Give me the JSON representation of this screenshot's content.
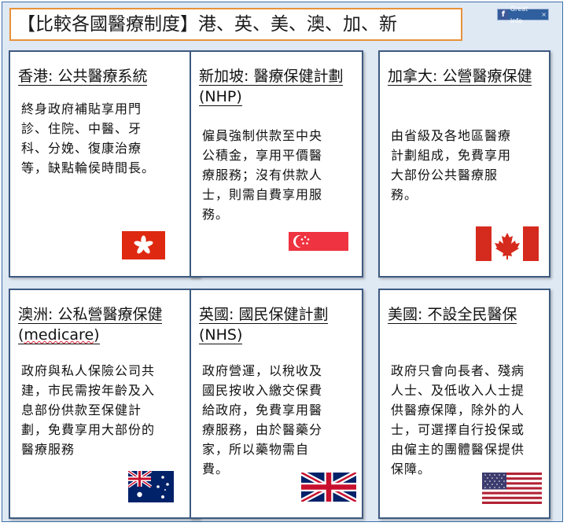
{
  "title": "【比較各國醫療制度】港、英、美、澳、加、新",
  "badge": {
    "fb": "f",
    "label": "Great Info",
    "close": "×"
  },
  "cards": [
    {
      "heading": "香港: 公共醫療系統",
      "body": "終身政府補貼享用門診、住院、中醫、牙科、分娩、復康治療等，缺點輪侯時間長。",
      "flag": "hong-kong-flag"
    },
    {
      "heading": "新加坡: 醫療保健計劃(NHP)",
      "body": "僱員強制供款至中央公積金，享用平價醫療服務；沒有供款人士，則需自費享用服務。",
      "flag": "singapore-flag"
    },
    {
      "heading": "加拿大: 公營醫療保健",
      "body": "由省級及各地區醫療計劃組成，免費享用大部份公共醫療服務。",
      "flag": "canada-flag"
    },
    {
      "heading_a": "澳洲: 公私營醫療保健(",
      "heading_b": "medicare",
      "heading_c": ")",
      "body": "政府與私人保險公司共建，市民需按年齡及入息部份供款至保健計劃，免費享用大部份的醫療服務",
      "flag": "australia-flag"
    },
    {
      "heading": "英國: 國民保健計劃(NHS)",
      "body": "政府營運，以稅收及國民按收入繳交保費給政府，免費享用醫療服務，由於醫藥分家，所以藥物需自費。",
      "flag": "uk-flag"
    },
    {
      "heading": "美國: 不設全民醫保",
      "body": "政府只會向長者、殘病人士、及低收入人士提供醫療保障，除外的人士，可選擇自行投保或由僱主的團體醫保提供保障。",
      "flag": "usa-flag"
    }
  ]
}
